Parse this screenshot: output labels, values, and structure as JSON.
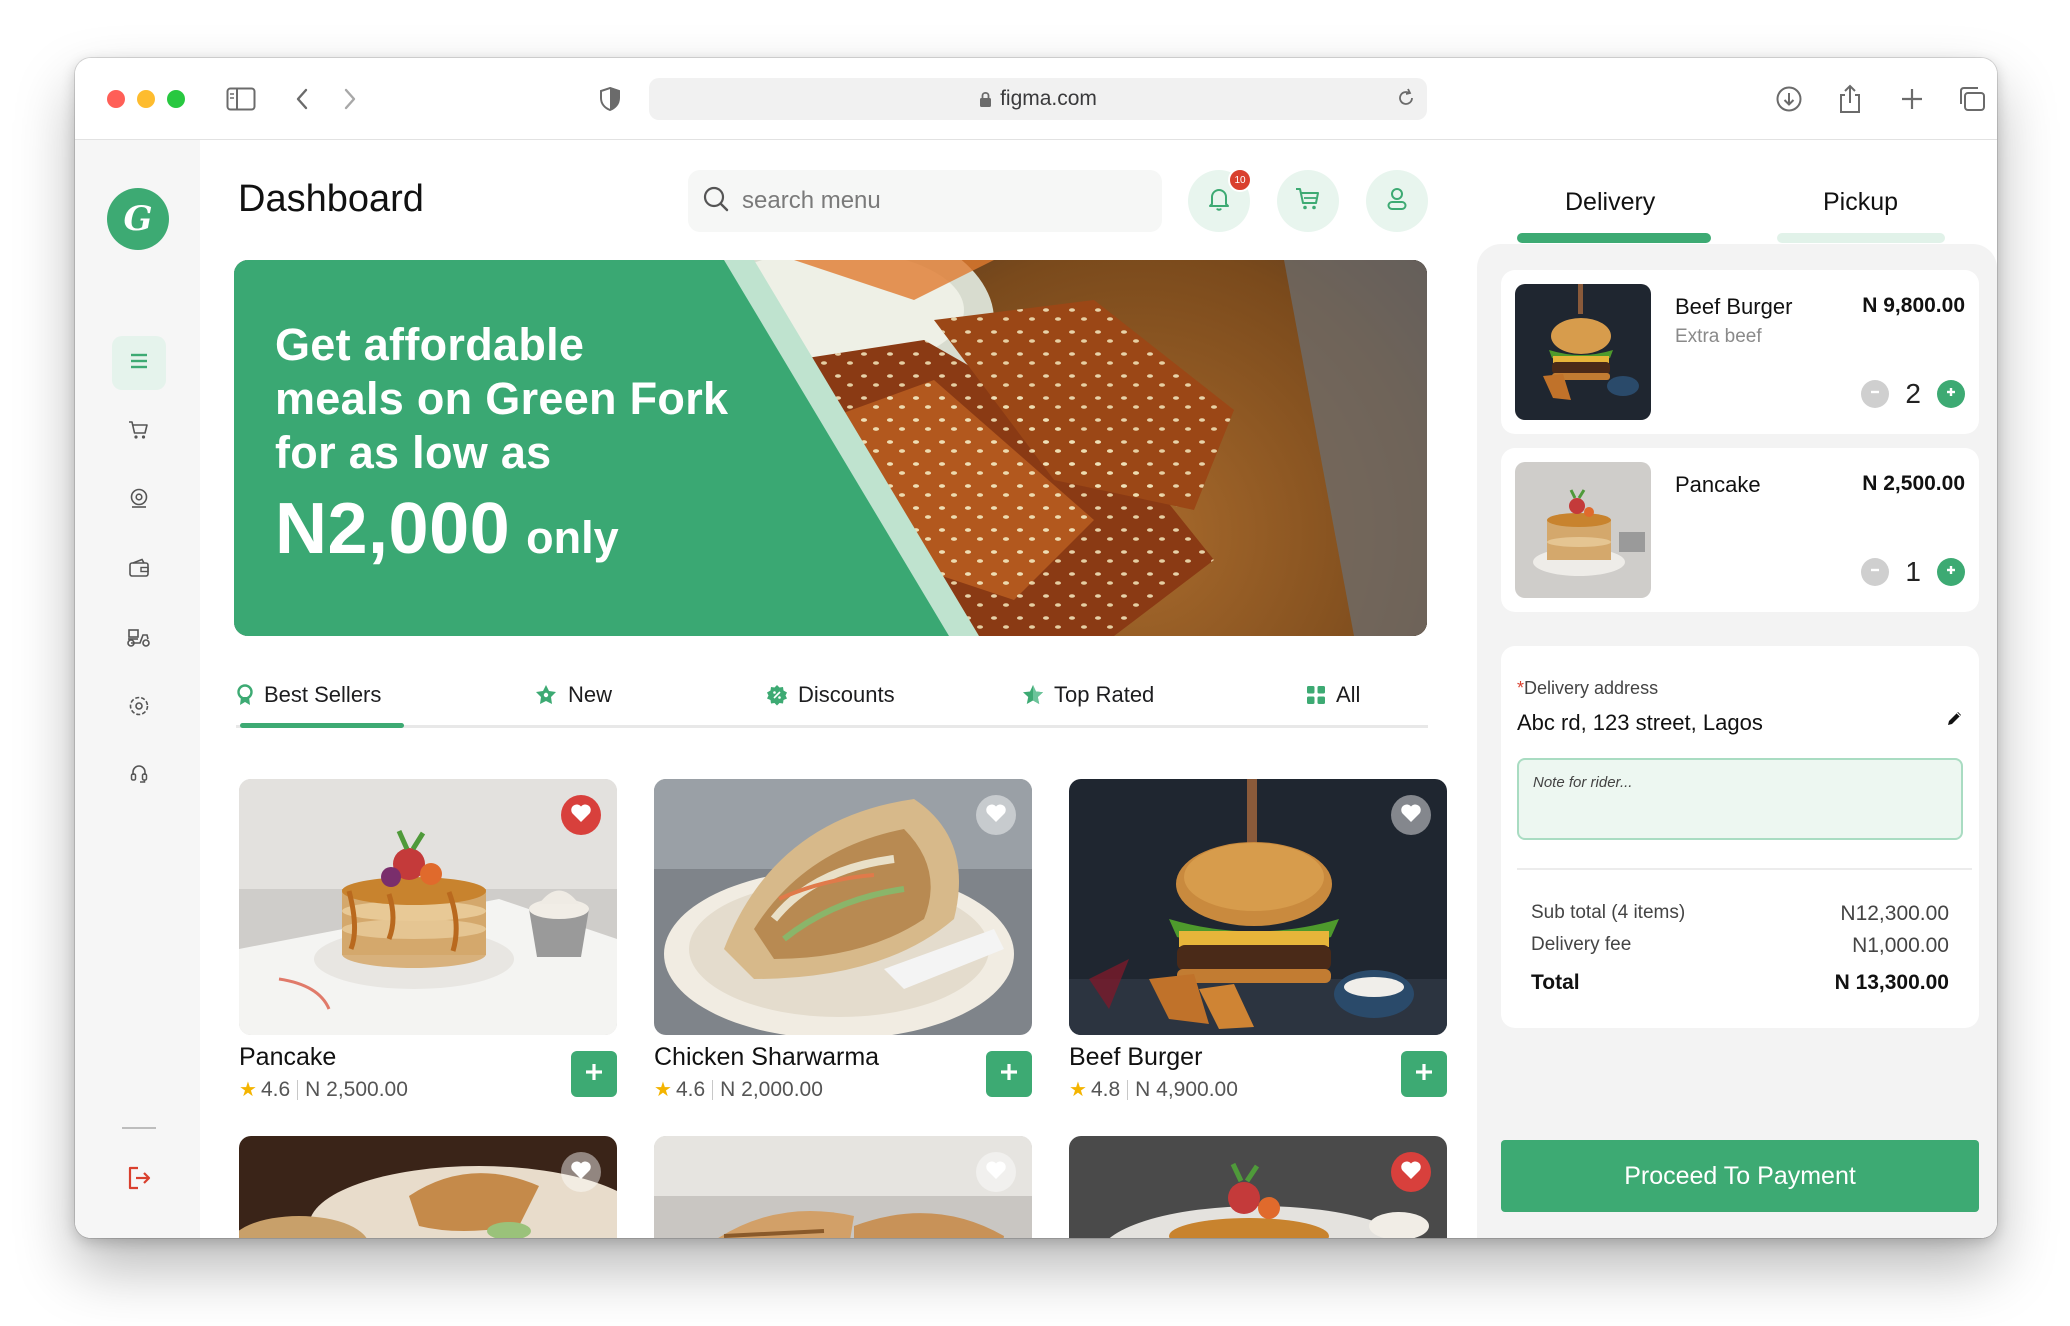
{
  "browser": {
    "url": "figma.com"
  },
  "sidebar": {
    "logo_letter": "G",
    "items": [
      {
        "icon": "menu-icon",
        "active": true
      },
      {
        "icon": "cart-icon",
        "active": false
      },
      {
        "icon": "location-icon",
        "active": false
      },
      {
        "icon": "wallet-icon",
        "active": false
      },
      {
        "icon": "delivery-scooter-icon",
        "active": false
      },
      {
        "icon": "settings-icon",
        "active": false
      },
      {
        "icon": "support-icon",
        "active": false
      }
    ],
    "logout_icon": "logout-icon"
  },
  "header": {
    "title": "Dashboard",
    "search_placeholder": "search menu",
    "notification_count": "10"
  },
  "banner": {
    "line1": "Get affordable",
    "line2": "meals on Green Fork",
    "line3": "for as low as",
    "price": "N2,000",
    "suffix": "only"
  },
  "categories": [
    {
      "label": "Best Sellers",
      "icon": "medal-icon",
      "active": true
    },
    {
      "label": "New",
      "icon": "new-badge-icon",
      "active": false
    },
    {
      "label": "Discounts",
      "icon": "discount-icon",
      "active": false
    },
    {
      "label": "Top Rated",
      "icon": "star-icon",
      "active": false
    },
    {
      "label": "All",
      "icon": "grid-icon",
      "active": false
    }
  ],
  "menu": [
    {
      "name": "Pancake",
      "rating": "4.6",
      "price": "N 2,500.00",
      "favorite": true
    },
    {
      "name": "Chicken Sharwarma",
      "rating": "4.6",
      "price": "N 2,000.00",
      "favorite": false
    },
    {
      "name": "Beef Burger",
      "rating": "4.8",
      "price": "N 4,900.00",
      "favorite": false
    },
    {
      "name": "",
      "rating": "",
      "price": "",
      "favorite": false
    },
    {
      "name": "",
      "rating": "",
      "price": "",
      "favorite": false
    },
    {
      "name": "",
      "rating": "",
      "price": "",
      "favorite": true
    }
  ],
  "order": {
    "tabs": [
      "Delivery",
      "Pickup"
    ],
    "active_tab": "Delivery",
    "items": [
      {
        "name": "Beef Burger",
        "note": "Extra beef",
        "price": "N 9,800.00",
        "qty": "2"
      },
      {
        "name": "Pancake",
        "note": "",
        "price": "N 2,500.00",
        "qty": "1"
      }
    ],
    "address_label": "Delivery address",
    "address_required_mark": "*",
    "address": "Abc rd, 123 street, Lagos",
    "note_placeholder": "Note for rider...",
    "subtotal_label": "Sub total (4 items)",
    "subtotal": "N12,300.00",
    "fee_label": "Delivery fee",
    "fee": "N1,000.00",
    "total_label": "Total",
    "total": "N 13,300.00",
    "pay_label": "Proceed To Payment"
  },
  "colors": {
    "brand_green": "#3daa73",
    "light_green": "#e8f5ee",
    "favorite_red": "#d8403c",
    "badge_red": "#d9402e",
    "rating_star": "#f4b400"
  }
}
